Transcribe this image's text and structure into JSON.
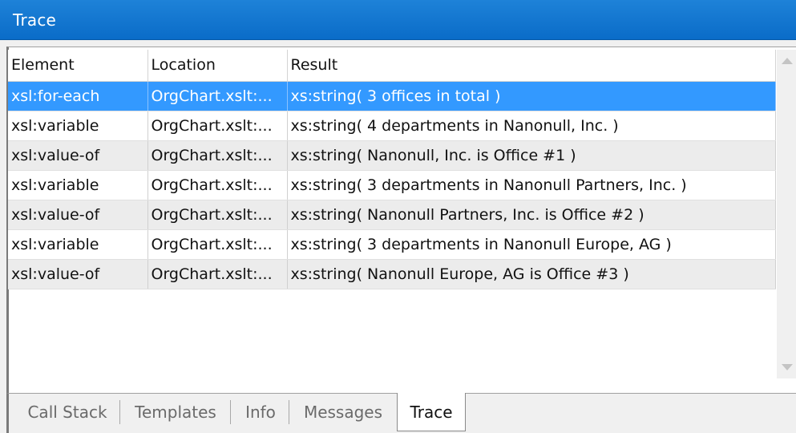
{
  "window": {
    "title": "Trace"
  },
  "table": {
    "columns": [
      "Element",
      "Location",
      "Result"
    ],
    "rows": [
      {
        "element": "xsl:for-each",
        "location": "OrgChart.xslt:...",
        "result": "xs:string( 3 offices in total )",
        "selected": true
      },
      {
        "element": "xsl:variable",
        "location": "OrgChart.xslt:...",
        "result": "xs:string( 4 departments in Nanonull, Inc. )",
        "selected": false
      },
      {
        "element": "xsl:value-of",
        "location": "OrgChart.xslt:...",
        "result": "xs:string( Nanonull, Inc. is Office #1 )",
        "selected": false
      },
      {
        "element": "xsl:variable",
        "location": "OrgChart.xslt:...",
        "result": "xs:string( 3 departments in Nanonull Partners, Inc. )",
        "selected": false
      },
      {
        "element": "xsl:value-of",
        "location": "OrgChart.xslt:...",
        "result": "xs:string( Nanonull Partners, Inc. is Office #2 )",
        "selected": false
      },
      {
        "element": "xsl:variable",
        "location": "OrgChart.xslt:...",
        "result": "xs:string( 3 departments in Nanonull Europe, AG )",
        "selected": false
      },
      {
        "element": "xsl:value-of",
        "location": "OrgChart.xslt:...",
        "result": "xs:string( Nanonull Europe, AG is Office #3 )",
        "selected": false
      }
    ]
  },
  "tabs": [
    {
      "label": "Call Stack",
      "active": false
    },
    {
      "label": "Templates",
      "active": false
    },
    {
      "label": "Info",
      "active": false
    },
    {
      "label": "Messages",
      "active": false
    },
    {
      "label": "Trace",
      "active": true
    }
  ],
  "scrollbar": {
    "up_icon": "scroll-up-arrow-icon",
    "down_icon": "scroll-down-arrow-icon"
  },
  "colors": {
    "titlebar": "#0a6cc8",
    "selection": "#3399ff",
    "alt_row": "#ececec"
  }
}
